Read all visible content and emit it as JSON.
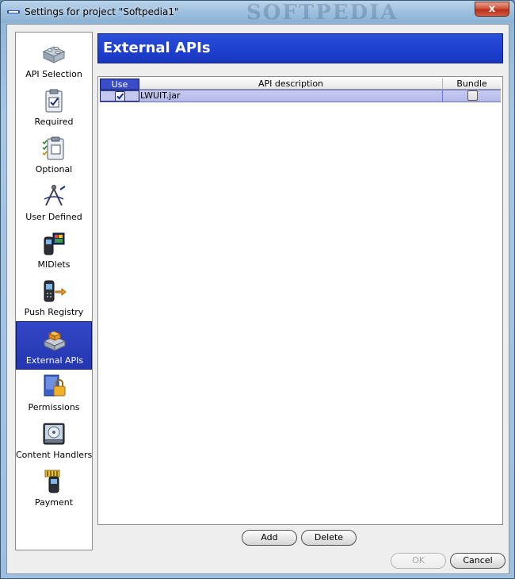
{
  "window": {
    "title": "Settings for project \"Softpedia1\"",
    "watermark": "SOFTPEDIA",
    "close_label": "x"
  },
  "sidebar": {
    "items": [
      {
        "label": "API Selection",
        "icon": "lego-blocks-icon",
        "selected": false
      },
      {
        "label": "Required",
        "icon": "clipboard-check-icon",
        "selected": false
      },
      {
        "label": "Optional",
        "icon": "checklist-icon",
        "selected": false
      },
      {
        "label": "User Defined",
        "icon": "compass-drawing-icon",
        "selected": false
      },
      {
        "label": "MIDlets",
        "icon": "phone-screen-icon",
        "selected": false
      },
      {
        "label": "Push Registry",
        "icon": "phone-arrow-icon",
        "selected": false
      },
      {
        "label": "External APIs",
        "icon": "lego-blocks-orange-icon",
        "selected": true
      },
      {
        "label": "Permissions",
        "icon": "lock-icon",
        "selected": false
      },
      {
        "label": "Content Handlers",
        "icon": "cd-drive-icon",
        "selected": false
      },
      {
        "label": "Payment",
        "icon": "phone-coins-icon",
        "selected": false
      }
    ]
  },
  "header": {
    "title": "External APIs"
  },
  "table": {
    "columns": [
      "Use",
      "API description",
      "Bundle"
    ],
    "rows": [
      {
        "use": true,
        "description": "LWUIT.jar",
        "bundle": false
      }
    ]
  },
  "buttons": {
    "add": "Add",
    "delete": "Delete",
    "ok": "OK",
    "cancel": "Cancel"
  },
  "colors": {
    "selection_blue": "#2436b0",
    "header_blue": "#1d3fcf"
  }
}
